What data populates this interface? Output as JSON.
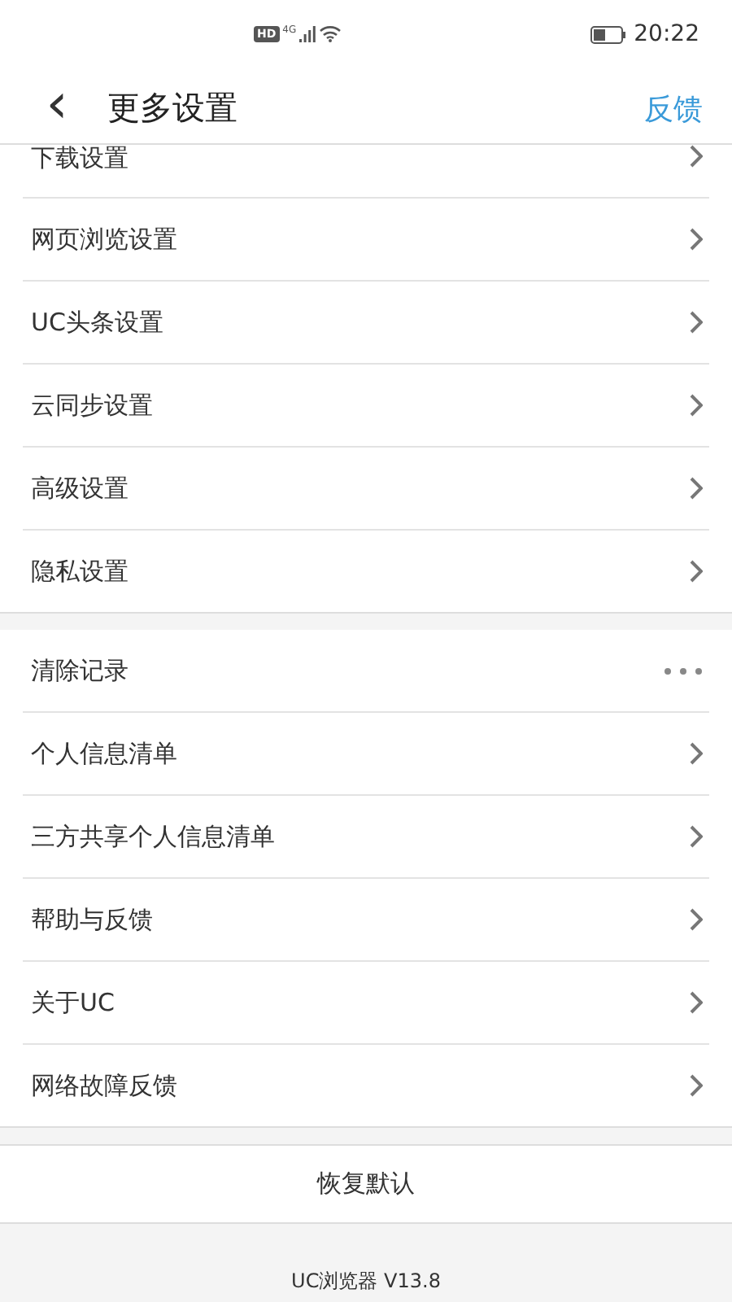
{
  "status_bar": {
    "hd": "HD",
    "network": "4G",
    "time": "20:22"
  },
  "header": {
    "back": "‹",
    "title": "更多设置",
    "action": "反馈"
  },
  "groups": [
    {
      "items": [
        {
          "label": "下载设置",
          "kind": "chevron",
          "partial": true
        },
        {
          "label": "网页浏览设置",
          "kind": "chevron"
        },
        {
          "label": "UC头条设置",
          "kind": "chevron"
        },
        {
          "label": "云同步设置",
          "kind": "chevron"
        },
        {
          "label": "高级设置",
          "kind": "chevron"
        },
        {
          "label": "隐私设置",
          "kind": "chevron"
        }
      ]
    },
    {
      "items": [
        {
          "label": "清除记录",
          "kind": "more"
        },
        {
          "label": "个人信息清单",
          "kind": "chevron"
        },
        {
          "label": "三方共享个人信息清单",
          "kind": "chevron"
        },
        {
          "label": "帮助与反馈",
          "kind": "chevron"
        },
        {
          "label": "关于UC",
          "kind": "chevron"
        },
        {
          "label": "网络故障反馈",
          "kind": "chevron"
        }
      ]
    }
  ],
  "reset_button": "恢复默认",
  "version": "UC浏览器 V13.8"
}
